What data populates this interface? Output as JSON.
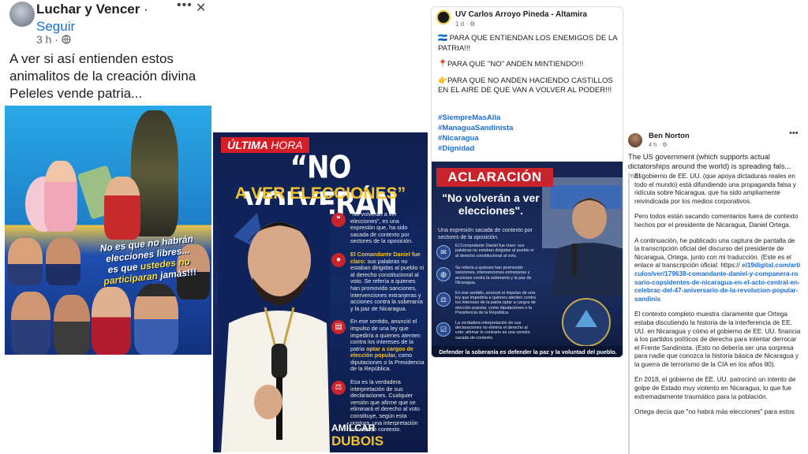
{
  "panel1": {
    "author": "Luchar y Vencer",
    "separator": "·",
    "follow": "Seguir",
    "time": "3 h ·",
    "menu_icon": "more-horizontal-icon",
    "close_icon": "close-icon",
    "privacy_icon": "globe-icon",
    "text_lines": [
      "A ver si así entienden estos",
      "animalitos de la creación divina",
      "Peleles vende patria..."
    ],
    "image_text_1": "No es que no habrán",
    "image_text_2": "elecciones libres...",
    "image_text_3": "es que",
    "image_text_4": "ustedes no",
    "image_text_5": "participaran",
    "image_text_6": "jamás!!!"
  },
  "panel2": {
    "tag_ultima": "ÚLTIMA",
    "tag_hora": "HORA",
    "headline_1": "“NO VOLVERÁN",
    "headline_2": "A VER ELECCIONES”",
    "item_1": "“No volverán a ver elecciones”, es una expresión que, ha sido sacada de contexto por sectores de la oposición.",
    "item_2a": "El Comandante Daniel fue claro:",
    "item_2b": "sus palabras no estaban dirigidas al pueblo ni al derecho constitucional al voto. Se refería a quienes han promovido sanciones, intervenciones extranjeras y acciones contra la soberanía y la paz de Nicaragua.",
    "item_3a": "En ese sentido, anunció el impulso de una ley que impediría a quienes atenten contra los intereses de la patria",
    "item_3b": "optar a cargos de elección popular,",
    "item_3c": "como diputaciones o la Presidencia de la República.",
    "item_4": "Esa es la verdadera interpretación de sus declaraciones. Cualquier versión que afirme que se eliminará el derecho al voto constituye, según esta postura, una interpretación sacada de contexto.",
    "signature_1": "AMÍLCAR",
    "signature_2": "DUBOIS"
  },
  "panel3": {
    "author": "UV Carlos Arroyo Pineda - Altamira",
    "meta": "1 d · ⚙",
    "line_1": "🇳🇮 PARA QUE ENTIENDAN LOS ENEMIGOS DE LA PATRIA!!!",
    "line_2": "📍PARA QUE \"NO\" ANDEN MINTIENDO!!!",
    "line_3": "👉PARA QUE NO ANDEN HACIENDO CASTILLOS EN EL AIRE DE QUE VAN A VOLVER AL PODER!!!",
    "hashtags": [
      "#SiempreMasAlla",
      "#ManaguaSandinista",
      "#Nicaragua",
      "#Dignidad"
    ],
    "aclaracion": "ACLARACIÓN",
    "quote": "\"No volverán a ver elecciones\".",
    "subtitle": "Una expresión sacada de contexto por sectores de la oposición.",
    "row_1": "El Comandante Daniel fue claro: sus palabras no estaban dirigidas al pueblo ni al derecho constitucional al voto.",
    "row_2": "Se refería a quienes han promovido sanciones, intervenciones extranjeras y acciones contra la soberanía y la paz de Nicaragua.",
    "row_3": "En ese sentido, anunció el impulso de una ley que impediría a quienes atenten contra los intereses de la patria optar a cargos de elección popular, como diputaciones o la Presidencia de la República.",
    "row_4": "La verdadera interpretación de sus declaraciones no elimina el derecho al voto: afirmar lo contrario es una versión sacada de contexto.",
    "footer": "Defender la soberanía es defender la paz y la voluntad del pueblo."
  },
  "panel4": {
    "author": "Ben Norton",
    "meta": "4 h · ⚙",
    "menu_icon": "more-horizontal-icon",
    "intro": "The US government (which supports actual dictatorships around the world) is spreading fals...",
    "more": "más",
    "p1": "El gobierno de EE. UU. (que apoya dictaduras reales en todo el mundo) está difundiendo una propaganda falsa y ridícula sobre Nicaragua, que ha sido ampliamente reivindicada por los medios corporativos.",
    "p2": "Pero todos están sacando comentarios fuera de contexto hechos por el presidente de Nicaragua, Daniel Ortega.",
    "p3a": "A continuación, he publicado una captura de pantalla de la transcripción oficial del discurso del presidente de Nicaragua, Ortega, junto con mi traducción. (Este es el enlace al transcripción oficial: https://",
    "p3b": "el19digital.com/articulos/ver/179638-comandante-daniel-y-companera-rosario-copsidentes-de-nicaragua-en-el-acto-central-en-celebrac-del-47-aniversario-de-la-revolucion-popular-sandinis",
    "p4": "El contexto completo muestra claramente que Ortega estaba discutiendo la historia de la interferencia de EE. UU. en Nicaragua y cómo el gobierno de EE. UU. financia a los partidos políticos de derecha para intentar derrocar el Frente Sandinista. (Esto no debería ser una sorpresa para nadie que conozca la historia básica de Nicaragua y la guerra de terrorismo de la CIA en los años 80).",
    "p5": "En 2018, el gobierno de EE. UU. patrocinó un intento de golpe de Estado muy violento en Nicaragua, lo que fue extremadamente traumático para la población.",
    "p6": "Ortega decía que \"no habrá más elecciones\" para estos"
  }
}
